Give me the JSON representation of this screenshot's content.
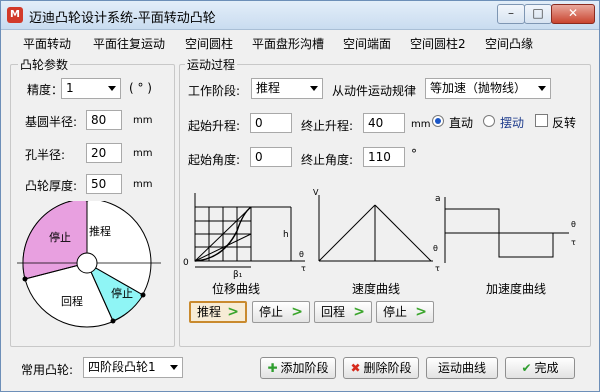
{
  "window": {
    "title": "迈迪凸轮设计系统-平面转动凸轮",
    "app_icon": "M",
    "min": "–",
    "max": "□",
    "close": "✕"
  },
  "menu": [
    "平面转动",
    "平面往复运动",
    "空间圆柱",
    "平面盘形沟槽",
    "空间端面",
    "空间圆柱2",
    "空间凸缘"
  ],
  "cam_params": {
    "legend": "凸轮参数",
    "precision_label": "精度：",
    "precision_value": "1",
    "precision_unit": "( ° )",
    "base_radius_label": "基圆半径:",
    "base_radius_value": "80",
    "base_radius_unit": "mm",
    "hole_radius_label": "孔半径:",
    "hole_radius_value": "20",
    "hole_radius_unit": "mm",
    "thickness_label": "凸轮厚度:",
    "thickness_value": "50",
    "thickness_unit": "mm",
    "diagram": {
      "stop1": "停止",
      "push": "推程",
      "return": "回程",
      "stop2": "停止",
      "colors": {
        "stop1": "#e8a0e0",
        "stop2": "#8ff5f5"
      }
    }
  },
  "motion": {
    "legend": "运动过程",
    "phase_label": "工作阶段:",
    "phase_value": "推程",
    "law_label": "从动件运动规律",
    "law_value": "等加速（抛物线）",
    "start_lift_label": "起始升程:",
    "start_lift_value": "0",
    "end_lift_label": "终止升程:",
    "end_lift_value": "40",
    "lift_unit": "mm",
    "mode_direct": "直动",
    "mode_swing": "摆动",
    "reverse_label": "反转",
    "start_angle_label": "起始角度:",
    "start_angle_value": "0",
    "end_angle_label": "终止角度:",
    "end_angle_value": "110",
    "angle_unit": "°",
    "curve_captions": [
      "位移曲线",
      "速度曲线",
      "加速度曲线"
    ],
    "graph_labels": {
      "s": "s",
      "h": "h",
      "zero": "0",
      "beta": "β₁",
      "v": "V",
      "theta": "θ",
      "tau": "τ",
      "a": "a"
    },
    "phases": [
      {
        "label": "推程",
        "selected": true
      },
      {
        "label": "停止",
        "selected": false
      },
      {
        "label": "回程",
        "selected": false
      },
      {
        "label": "停止",
        "selected": false
      }
    ]
  },
  "bottom": {
    "common_cam_label": "常用凸轮:",
    "common_cam_value": "四阶段凸轮1",
    "add_phase": "添加阶段",
    "delete_phase": "删除阶段",
    "motion_curve": "运动曲线",
    "finish": "完成"
  }
}
